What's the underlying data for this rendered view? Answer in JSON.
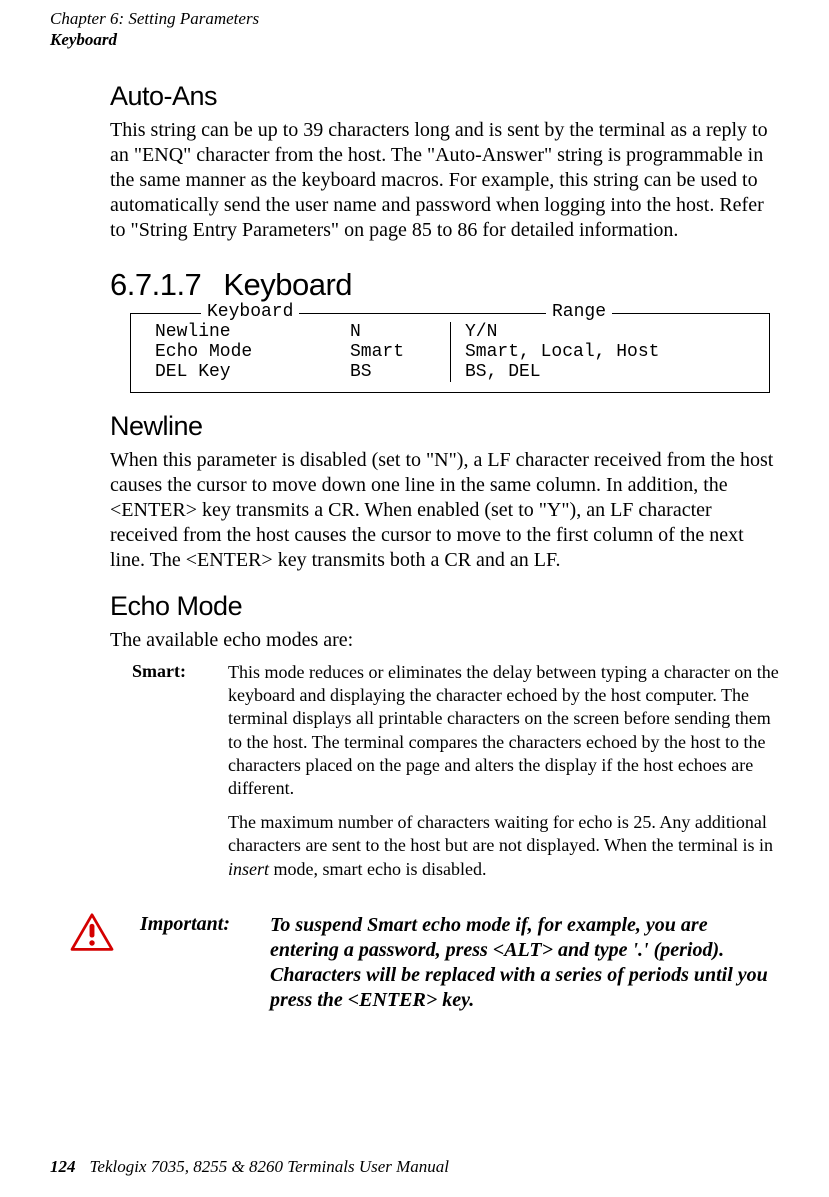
{
  "running_head": {
    "chapter": "Chapter 6: Setting Parameters",
    "topic": "Keyboard"
  },
  "auto_ans": {
    "heading": "Auto-Ans",
    "body": "This string can be up to 39 characters long and is sent by the terminal as a reply to an \"ENQ\" character from the host. The \"Auto-Answer\" string is programmable in the same manner as the keyboard macros. For example, this string can be used to automatically send the user name and password when logging into the host. Refer to \"String Entry Parameters\" on page 85 to 86 for detailed information."
  },
  "keyboard_section": {
    "number": "6.7.1.7",
    "title": "Keyboard",
    "legend_left": "Keyboard",
    "legend_right": "Range",
    "rows": [
      {
        "name": "Newline",
        "value": "N",
        "range": "Y/N"
      },
      {
        "name": "Echo Mode",
        "value": "Smart",
        "range": "Smart, Local, Host"
      },
      {
        "name": "DEL Key",
        "value": "BS",
        "range": "BS, DEL"
      }
    ]
  },
  "newline": {
    "heading": "Newline",
    "body": "When this parameter is disabled (set to \"N\"), a LF character received from the host causes the cursor to move down one line in the same column. In addition, the <ENTER> key transmits a CR. When enabled (set to \"Y\"), an LF character received from the host causes the cursor to move to the first column of the next line. The <ENTER> key transmits both a CR and an LF."
  },
  "echo_mode": {
    "heading": "Echo Mode",
    "intro": "The available echo modes are:",
    "smart": {
      "label": "Smart:",
      "p1": "This mode reduces or eliminates the delay between typing a character on the keyboard and displaying the character echoed by the host computer. The terminal displays all printable characters on the screen before sending them to the host. The terminal compares the characters echoed by the host to the characters placed on the page and alters the display if the host echoes are different.",
      "p2_pre": "The maximum number of characters waiting for echo is 25. Any additional characters are sent to the host but are not displayed. When the terminal is in ",
      "p2_em": "insert",
      "p2_post": " mode, smart echo is disabled."
    }
  },
  "important": {
    "label": "Important:",
    "text": "To suspend Smart echo mode if, for example, you are entering a password, press <ALT> and type '.' (period). Characters will be replaced with a series of periods until you press the <ENTER> key."
  },
  "footer": {
    "page": "124",
    "title": "Teklogix 7035, 8255 & 8260 Terminals User Manual"
  }
}
